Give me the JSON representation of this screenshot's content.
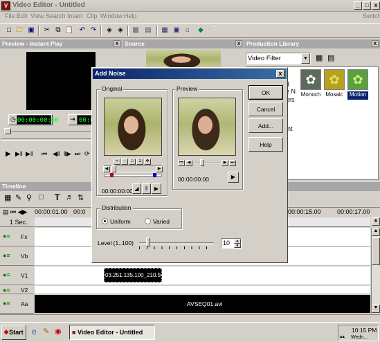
{
  "window": {
    "title": "Video Editor - Untitled",
    "min_label": "_",
    "max_label": "□",
    "close_label": "x"
  },
  "menu": {
    "items": [
      "File",
      "Edit",
      "View",
      "Search",
      "Insert",
      "Clip",
      "Window",
      "Help"
    ],
    "switch_label": "Switch"
  },
  "toolbar": {
    "icons": [
      "new-icon",
      "open-icon",
      "save-icon",
      "cut-icon",
      "copy-icon",
      "paste-icon",
      "undo-icon",
      "redo-icon",
      "find-icon",
      "find-next-icon",
      "capture-icon",
      "import-icon",
      "library-icon",
      "properties-icon",
      "layout-icon",
      "effect-icon",
      "help-pointer-icon"
    ]
  },
  "preview_panel": {
    "title": "Preview - Instant Play",
    "timecode_start": "00:00:00:00",
    "timecode_end": "00:00:0"
  },
  "source_panel": {
    "title": "Source"
  },
  "library": {
    "title": "Production Library",
    "category": "Video Filter",
    "side_fragments": [
      "g",
      "e N",
      "ers",
      "int"
    ],
    "items": [
      {
        "label": "Monoch",
        "color": "#5d6b5d"
      },
      {
        "label": "Mosaic",
        "color": "#b8a020"
      },
      {
        "label": "Motion",
        "color": "#5aa040"
      }
    ]
  },
  "dialog": {
    "title": "Add Noise",
    "original_label": "Original",
    "preview_label": "Preview",
    "original_timecode": "00:00:00:00",
    "preview_timecode": "00:00:00:00",
    "buttons": {
      "ok": "OK",
      "cancel": "Cancel",
      "add": "Add...",
      "help": "Help"
    },
    "distribution": {
      "label": "Distribution",
      "options": [
        "Uniform",
        "Varied"
      ],
      "selected": "Uniform"
    },
    "level": {
      "label": "Level (1..100)",
      "value": "10",
      "slider_fraction": 0.1
    }
  },
  "timeline": {
    "title": "Timeline",
    "ruler": [
      "00:00:01.00",
      "00:0",
      "00:00:15.00",
      "00:00:17.00"
    ],
    "zoom": "1 Sec.",
    "tracks": [
      {
        "name": "Fx"
      },
      {
        "name": "Vb"
      },
      {
        "name": "V1"
      },
      {
        "name": "V2"
      },
      {
        "name": "Aa"
      }
    ],
    "v1_clip": "03.251.135.100_210.50",
    "aa_clip": "AVSEQ01.avi"
  },
  "taskbar": {
    "start": "Start",
    "task": "Video Editor - Untitled",
    "clock": "10:15 PM",
    "clock_sub": "Wedn..."
  }
}
